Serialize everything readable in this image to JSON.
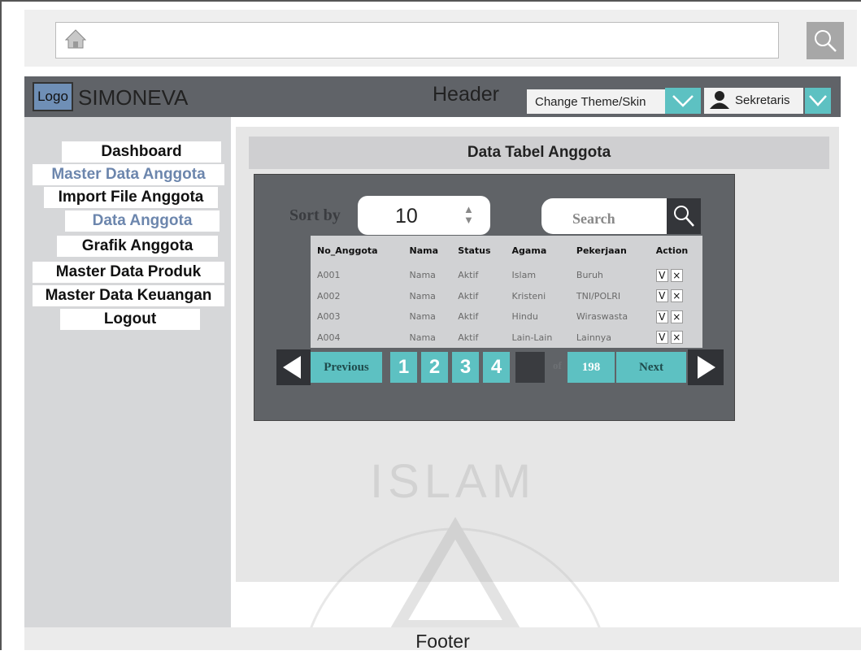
{
  "brand": {
    "logo_text": "Logo",
    "app_name": "SIMONEVA"
  },
  "header": {
    "label": "Header",
    "theme_selector": "Change Theme/Skin",
    "user_name": "Sekretaris"
  },
  "sidebar": {
    "items": [
      {
        "label": "Dashboard"
      },
      {
        "label": "Master Data Anggota"
      },
      {
        "label": "Import File Anggota"
      },
      {
        "label": "Data Anggota"
      },
      {
        "label": "Grafik Anggota"
      },
      {
        "label": "Master Data Produk"
      },
      {
        "label": "Master Data Keuangan"
      },
      {
        "label": "Logout"
      }
    ]
  },
  "main": {
    "title": "Data Tabel Anggota",
    "sort_label": "Sort by",
    "sort_value": "10",
    "search_placeholder": "Search",
    "table": {
      "headers": [
        "No_Anggota",
        "Nama",
        "Status",
        "Agama",
        "Pekerjaan",
        "Action"
      ],
      "rows": [
        [
          "A001",
          "Nama",
          "Aktif",
          "Islam",
          "Buruh"
        ],
        [
          "A002",
          "Nama",
          "Aktif",
          "Kristeni",
          "TNI/POLRI"
        ],
        [
          "A003",
          "Nama",
          "Aktif",
          "Hindu",
          "Wiraswasta"
        ],
        [
          "A004",
          "Nama",
          "Aktif",
          "Lain-Lain",
          "Lainnya"
        ]
      ],
      "action_labels": {
        "approve": "V",
        "delete": "×"
      }
    },
    "pagination": {
      "previous_label": "Previous",
      "pages": [
        "1",
        "2",
        "3",
        "4"
      ],
      "of_label": "of",
      "total": "198",
      "next_label": "Next"
    }
  },
  "watermark": {
    "text": "ISLAM"
  },
  "footer": {
    "label": "Footer"
  },
  "colors": {
    "accent": "#5dc1c2",
    "header_bg": "#606368",
    "sidebar_bg": "#d6d7d9",
    "panel_bg": "#606367",
    "submenu_text": "#6c86ad"
  }
}
